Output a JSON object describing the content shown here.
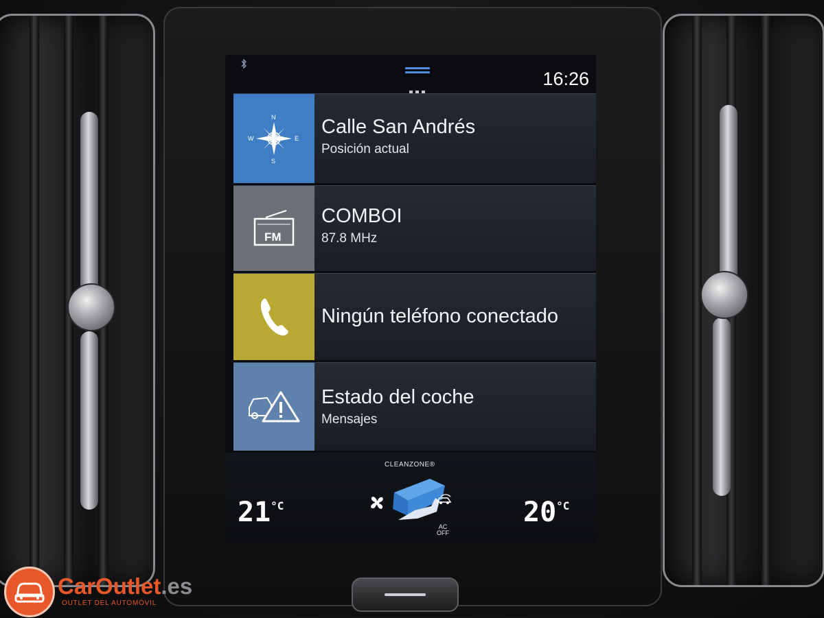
{
  "statusbar": {
    "bluetooth_icon": "bluetooth-icon",
    "clock": "16:26"
  },
  "tiles": [
    {
      "id": "navigation",
      "title": "Calle San Andrés",
      "subtitle": "Posición actual",
      "icon": "compass-icon",
      "icon_color": "#3f7ec4"
    },
    {
      "id": "media",
      "title": "COMBOI",
      "subtitle": "87.8 MHz",
      "icon": "fm-radio-icon",
      "icon_color": "#6a6f78"
    },
    {
      "id": "phone",
      "title": "Ningún teléfono conectado",
      "subtitle": "",
      "icon": "phone-icon",
      "icon_color": "#b8a834"
    },
    {
      "id": "car-status",
      "title": "Estado del coche",
      "subtitle": "Mensajes",
      "icon": "car-warning-icon",
      "icon_color": "#5f82ad"
    }
  ],
  "climate": {
    "cleanzone": "CLEANZONE®",
    "left_temp": "21",
    "right_temp": "20",
    "unit": "°C",
    "ac_status": "AC\nOFF"
  },
  "watermark": {
    "brand": "CarOutlet",
    "domain": ".es",
    "tagline": "OUTLET DEL AUTOMÓVIL"
  }
}
